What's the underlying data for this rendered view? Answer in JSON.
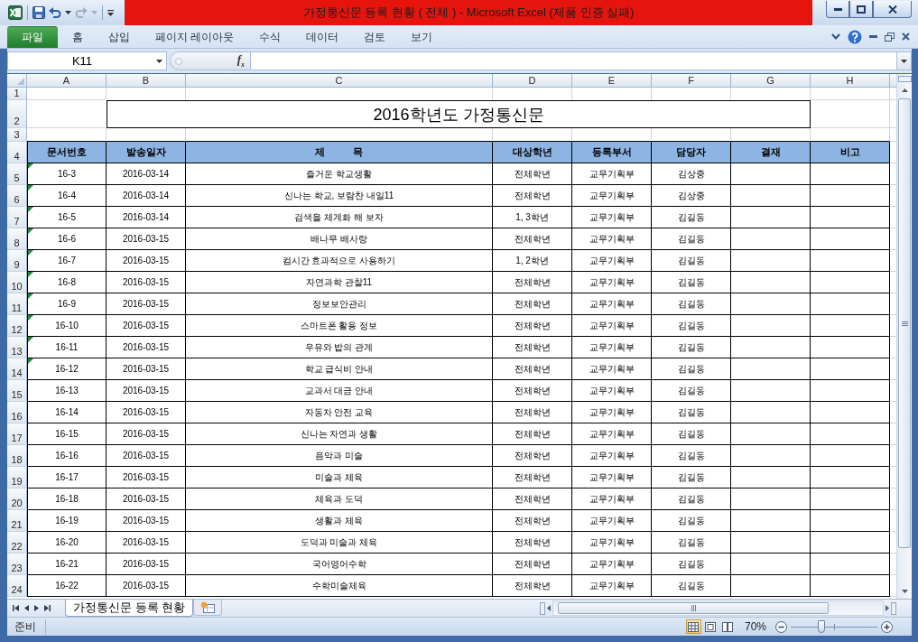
{
  "window": {
    "title": "가정통신문 등록 현황 ( 전체 ) - Microsoft Excel (제품 인증 실패)"
  },
  "ribbon": {
    "tabs": [
      {
        "label": "파일",
        "kind": "file",
        "selected": false
      },
      {
        "label": "홈",
        "kind": "tab",
        "selected": false
      },
      {
        "label": "삽입",
        "kind": "tab",
        "selected": false
      },
      {
        "label": "페이지 레이아웃",
        "kind": "tab",
        "selected": false
      },
      {
        "label": "수식",
        "kind": "tab",
        "selected": false
      },
      {
        "label": "데이터",
        "kind": "tab",
        "selected": false
      },
      {
        "label": "검토",
        "kind": "tab",
        "selected": false
      },
      {
        "label": "보기",
        "kind": "tab",
        "selected": false
      }
    ]
  },
  "formula_bar": {
    "name_box": "K11",
    "function_button": "f$_{x}$"
  },
  "sheet": {
    "column_letters": [
      "A",
      "B",
      "C",
      "D",
      "E",
      "F",
      "G",
      "H"
    ],
    "row_numbers": [
      "1",
      "2",
      "3",
      "4",
      "5",
      "6",
      "7",
      "8",
      "9",
      "10",
      "11",
      "12",
      "13",
      "14",
      "15",
      "16",
      "17",
      "18",
      "19",
      "20",
      "21",
      "22",
      "23",
      "24"
    ],
    "title": "2016학년도 가정통신문",
    "table": {
      "columns": [
        "문서번호",
        "발송일자",
        "제          목",
        "대상학년",
        "등록부서",
        "담당자",
        "결재",
        "비고"
      ],
      "rows": [
        {
          "cells": [
            "16-3",
            "2016-03-14",
            "즐거운 학교생활",
            "전체학년",
            "교무기획부",
            "김상중"
          ],
          "error_flag": true
        },
        {
          "cells": [
            "16-4",
            "2016-03-14",
            "신나는 학교, 보람찬 내일11",
            "전체학년",
            "교무기획부",
            "김상중"
          ],
          "error_flag": true
        },
        {
          "cells": [
            "16-5",
            "2016-03-14",
            "검색을 체계화 해 보자",
            "1, 3학년",
            "교무기획부",
            "김길동"
          ],
          "error_flag": true
        },
        {
          "cells": [
            "16-6",
            "2016-03-15",
            "배나무 배사랑",
            "전체학년",
            "교무기획부",
            "김길동"
          ],
          "error_flag": true
        },
        {
          "cells": [
            "16-7",
            "2016-03-15",
            "컴시간 효과적으로 사용하기",
            "1, 2학년",
            "교무기획부",
            "김길동"
          ],
          "error_flag": true
        },
        {
          "cells": [
            "16-8",
            "2016-03-15",
            "자연과학 관찰11",
            "전체학년",
            "교무기획부",
            "김길동"
          ],
          "error_flag": true
        },
        {
          "cells": [
            "16-9",
            "2016-03-15",
            "정보보안관리",
            "전체학년",
            "교무기획부",
            "김길동"
          ],
          "error_flag": true
        },
        {
          "cells": [
            "16-10",
            "2016-03-15",
            "스마트폰 활용 정보",
            "전체학년",
            "교무기획부",
            "김길동"
          ],
          "error_flag": true
        },
        {
          "cells": [
            "16-11",
            "2016-03-15",
            "우유와 밥의 관계",
            "전체학년",
            "교무기획부",
            "김길동"
          ],
          "error_flag": true
        },
        {
          "cells": [
            "16-12",
            "2016-03-15",
            "학교 급식비 안내",
            "전체학년",
            "교무기획부",
            "김길동"
          ],
          "error_flag": true
        },
        {
          "cells": [
            "16-13",
            "2016-03-15",
            "교과서 대금 안내",
            "전체학년",
            "교무기획부",
            "김길동"
          ],
          "error_flag": false
        },
        {
          "cells": [
            "16-14",
            "2016-03-15",
            "자동차 안전 교육",
            "전체학년",
            "교무기획부",
            "김길동"
          ],
          "error_flag": false
        },
        {
          "cells": [
            "16-15",
            "2016-03-15",
            "신나는 자연과 생활",
            "전체학년",
            "교무기획부",
            "김길동"
          ],
          "error_flag": false
        },
        {
          "cells": [
            "16-16",
            "2016-03-15",
            "음악과 미술",
            "전체학년",
            "교무기획부",
            "김길동"
          ],
          "error_flag": false
        },
        {
          "cells": [
            "16-17",
            "2016-03-15",
            "미술과 체육",
            "전체학년",
            "교무기획부",
            "김길동"
          ],
          "error_flag": false
        },
        {
          "cells": [
            "16-18",
            "2016-03-15",
            "체육과 도덕",
            "전체학년",
            "교무기획부",
            "김길동"
          ],
          "error_flag": false
        },
        {
          "cells": [
            "16-19",
            "2016-03-15",
            "생활과 체육",
            "전체학년",
            "교무기획부",
            "김길동"
          ],
          "error_flag": false
        },
        {
          "cells": [
            "16-20",
            "2016-03-15",
            "도덕과 미술과 체육",
            "전체학년",
            "교무기획부",
            "김길동"
          ],
          "error_flag": false
        },
        {
          "cells": [
            "16-21",
            "2016-03-15",
            "국어영어수학",
            "전체학년",
            "교무기획부",
            "김길동"
          ],
          "error_flag": false
        },
        {
          "cells": [
            "16-22",
            "2016-03-15",
            "수학미술체육",
            "전체학년",
            "교무기획부",
            "김길동"
          ],
          "error_flag": false
        }
      ]
    }
  },
  "sheet_tabs": [
    {
      "label": "가정통신문 등록 현황",
      "selected": true
    }
  ],
  "status_bar": {
    "status": "준비",
    "views": [
      {
        "kind": "normal",
        "selected": true
      },
      {
        "kind": "page_layout",
        "selected": false
      },
      {
        "kind": "page_break",
        "selected": false
      }
    ],
    "zoom": {
      "label": "70%",
      "level": 0.35
    }
  }
}
